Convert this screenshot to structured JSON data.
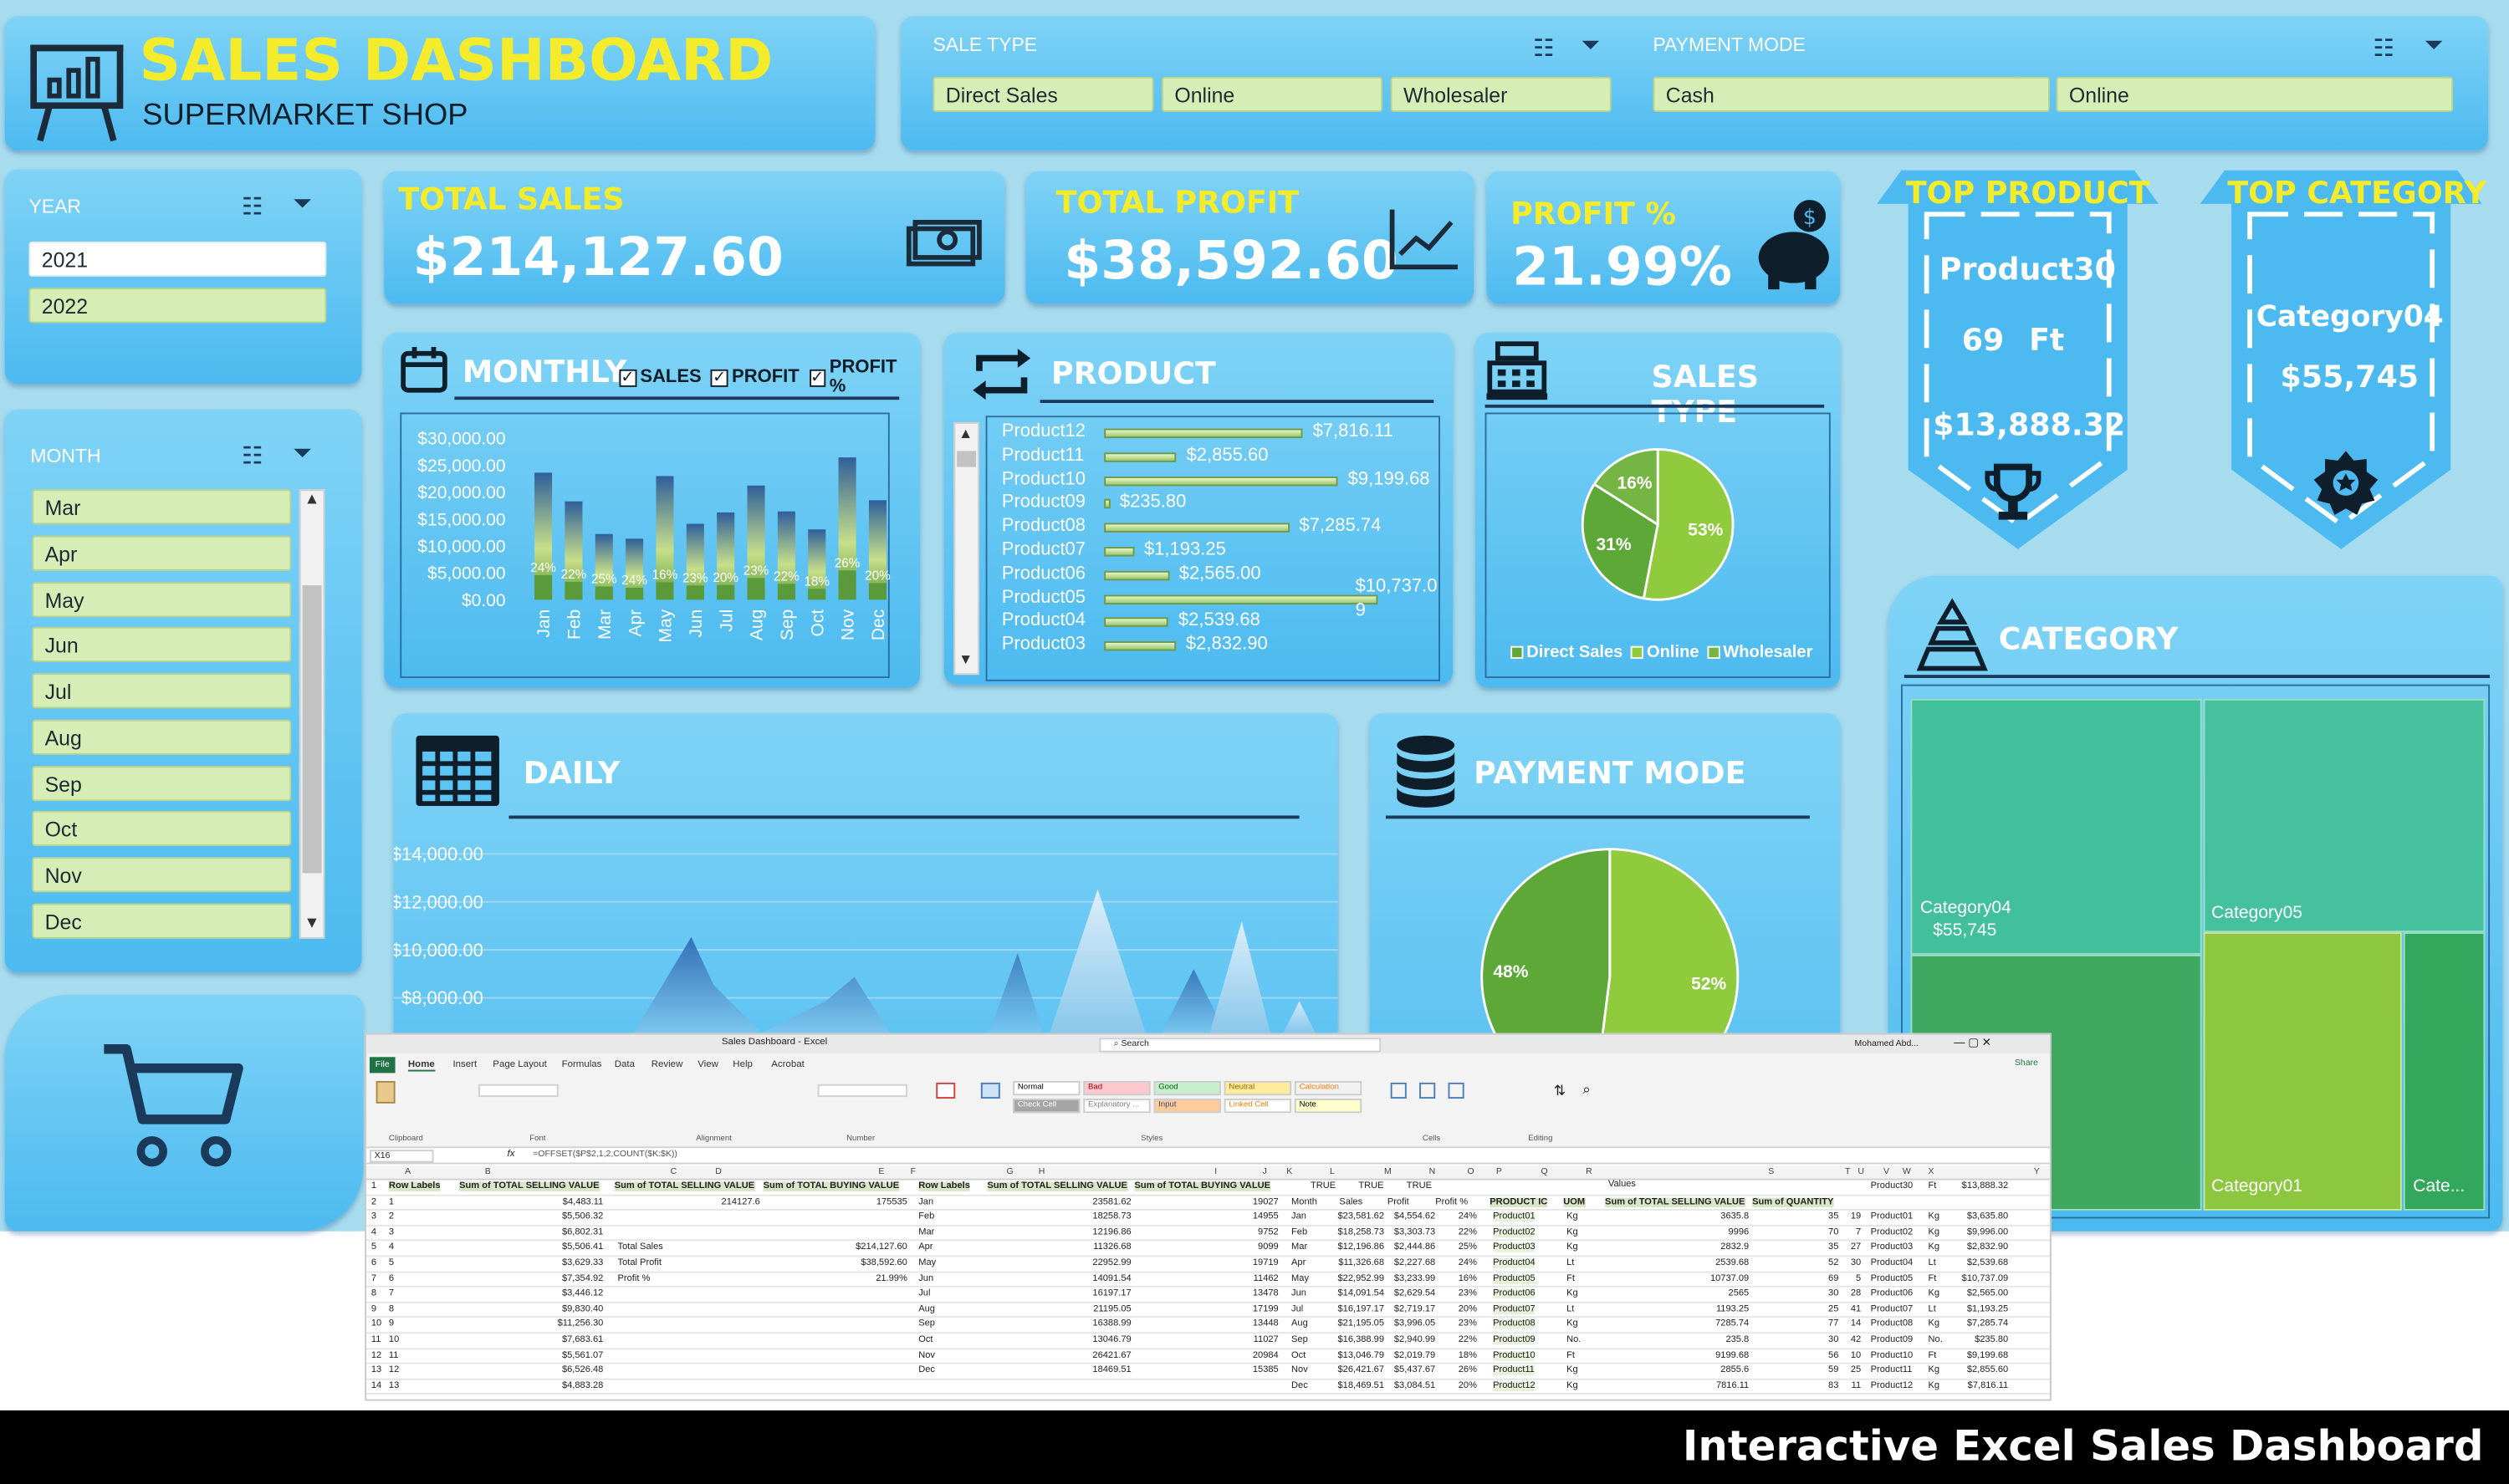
{
  "header": {
    "title": "SALES DASHBOARD",
    "subtitle": "SUPERMARKET SHOP"
  },
  "filters": {
    "sale_type": {
      "label": "SALE TYPE",
      "options": [
        "Direct Sales",
        "Online",
        "Wholesaler"
      ]
    },
    "payment_mode": {
      "label": "PAYMENT MODE",
      "options": [
        "Cash",
        "Online"
      ]
    },
    "year": {
      "label": "YEAR",
      "options": [
        "2021",
        "2022"
      ]
    },
    "month": {
      "label": "MONTH",
      "options": [
        "Mar",
        "Apr",
        "May",
        "Jun",
        "Jul",
        "Aug",
        "Sep",
        "Oct",
        "Nov",
        "Dec"
      ]
    }
  },
  "kpis": {
    "total_sales": {
      "label": "TOTAL SALES",
      "value": "$214,127.60"
    },
    "total_profit": {
      "label": "TOTAL PROFIT",
      "value": "$38,592.60"
    },
    "profit_pct": {
      "label": "PROFIT %",
      "value": "21.99%"
    }
  },
  "top_product": {
    "label": "TOP PRODUCT",
    "name": "Product30",
    "qty": "69",
    "uom": "Ft",
    "value": "$13,888.32"
  },
  "top_category": {
    "label": "TOP CATEGORY",
    "name": "Category04",
    "value": "$55,745"
  },
  "monthly": {
    "title": "MONTHLY",
    "checks": [
      "SALES",
      "PROFIT",
      "PROFIT %"
    ],
    "yticks": [
      "$30,000.00",
      "$25,000.00",
      "$20,000.00",
      "$15,000.00",
      "$10,000.00",
      "$5,000.00",
      "$0.00"
    ]
  },
  "product": {
    "title": "PRODUCT"
  },
  "sales_type": {
    "title": "SALES TYPE"
  },
  "daily": {
    "title": "DAILY",
    "yticks": [
      "$14,000.00",
      "$12,000.00",
      "$10,000.00",
      "$8,000.00"
    ]
  },
  "payment": {
    "title": "PAYMENT MODE"
  },
  "category": {
    "title": "CATEGORY",
    "labels": {
      "c04": "Category04",
      "c04v": "$55,745",
      "c05": "Category05",
      "c01": "Category01",
      "cate": "Cate..."
    }
  },
  "excel": {
    "title": "Sales Dashboard - Excel",
    "search": "Search",
    "user": "Mohamed Abd...",
    "share": "Share",
    "tabs": [
      "File",
      "Home",
      "Insert",
      "Page Layout",
      "Formulas",
      "Data",
      "Review",
      "View",
      "Help",
      "Acrobat"
    ],
    "name_box": "X16",
    "formula": "=OFFSET($P$2,1,2,COUNT($K:$K))",
    "styles": [
      "Normal",
      "Bad",
      "Good",
      "Neutral",
      "Calculation",
      "Check Cell",
      "Explanatory ...",
      "Input",
      "Linked Cell",
      "Note"
    ],
    "groups": [
      "Clipboard",
      "Font",
      "Alignment",
      "Number",
      "Styles",
      "Cells",
      "Editing"
    ],
    "col_letters": [
      "A",
      "B",
      "C",
      "D",
      "E",
      "F",
      "G",
      "H",
      "I",
      "J",
      "K",
      "L",
      "M",
      "N",
      "O",
      "P",
      "Q",
      "R",
      "S",
      "T",
      "U",
      "V",
      "W",
      "X",
      "Y"
    ],
    "t1_headers": [
      "Row Labels",
      "Sum of TOTAL SELLING VALUE"
    ],
    "t1_rows": [
      [
        "1",
        "$4,483.11"
      ],
      [
        "2",
        "$5,506.32"
      ],
      [
        "3",
        "$6,802.31"
      ],
      [
        "4",
        "$5,506.41"
      ],
      [
        "5",
        "$3,629.33"
      ],
      [
        "6",
        "$7,354.92"
      ],
      [
        "7",
        "$3,446.12"
      ],
      [
        "8",
        "$9,830.40"
      ],
      [
        "9",
        "$11,256.30"
      ],
      [
        "10",
        "$7,683.61"
      ],
      [
        "11",
        "$5,561.07"
      ],
      [
        "12",
        "$6,526.48"
      ],
      [
        "13",
        "$4,883.28"
      ]
    ],
    "t2_headers": [
      "Sum of TOTAL SELLING VALUE",
      "Sum of TOTAL BUYING VALUE"
    ],
    "t2_row": [
      "214127.6",
      "175535"
    ],
    "kpi_rows": [
      [
        "Total Sales",
        "$214,127.60"
      ],
      [
        "Total Profit",
        "$38,592.60"
      ],
      [
        "Profit %",
        "21.99%"
      ]
    ],
    "t3_headers": [
      "Row Labels",
      "Sum of TOTAL SELLING VALUE",
      "Sum of TOTAL BUYING VALUE"
    ],
    "t3_rows": [
      [
        "Jan",
        "23581.62",
        "19027"
      ],
      [
        "Feb",
        "18258.73",
        "14955"
      ],
      [
        "Mar",
        "12196.86",
        "9752"
      ],
      [
        "Apr",
        "11326.68",
        "9099"
      ],
      [
        "May",
        "22952.99",
        "19719"
      ],
      [
        "Jun",
        "14091.54",
        "11462"
      ],
      [
        "Jul",
        "16197.17",
        "13478"
      ],
      [
        "Aug",
        "21195.05",
        "17199"
      ],
      [
        "Sep",
        "16388.99",
        "13448"
      ],
      [
        "Oct",
        "13046.79",
        "11027"
      ],
      [
        "Nov",
        "26421.67",
        "20984"
      ],
      [
        "Dec",
        "18469.51",
        "15385"
      ]
    ],
    "t4_headers": [
      "",
      "TRUE",
      "TRUE",
      "TRUE"
    ],
    "t4_sub": [
      "Month",
      "Sales",
      "Profit",
      "Profit %"
    ],
    "t4_rows": [
      [
        "Jan",
        "$23,581.62",
        "$4,554.62",
        "24%"
      ],
      [
        "Feb",
        "$18,258.73",
        "$3,303.73",
        "22%"
      ],
      [
        "Mar",
        "$12,196.86",
        "$2,444.86",
        "25%"
      ],
      [
        "Apr",
        "$11,326.68",
        "$2,227.68",
        "24%"
      ],
      [
        "May",
        "$22,952.99",
        "$3,233.99",
        "16%"
      ],
      [
        "Jun",
        "$14,091.54",
        "$2,629.54",
        "23%"
      ],
      [
        "Jul",
        "$16,197.17",
        "$2,719.17",
        "20%"
      ],
      [
        "Aug",
        "$21,195.05",
        "$3,996.05",
        "23%"
      ],
      [
        "Sep",
        "$16,388.99",
        "$2,940.99",
        "22%"
      ],
      [
        "Oct",
        "$13,046.79",
        "$2,019.79",
        "18%"
      ],
      [
        "Nov",
        "$26,421.67",
        "$5,437.67",
        "26%"
      ],
      [
        "Dec",
        "$18,469.51",
        "$3,084.51",
        "20%"
      ]
    ],
    "t5_values": "Values",
    "t5_headers": [
      "PRODUCT IC",
      "UOM",
      "Sum of TOTAL SELLING VALUE",
      "Sum of QUANTITY"
    ],
    "t5_rows": [
      [
        "Product01",
        "Kg",
        "3635.8",
        "35"
      ],
      [
        "Product02",
        "Kg",
        "9996",
        "70"
      ],
      [
        "Product03",
        "Kg",
        "2832.9",
        "35"
      ],
      [
        "Product04",
        "Lt",
        "2539.68",
        "52"
      ],
      [
        "Product05",
        "Ft",
        "10737.09",
        "69"
      ],
      [
        "Product06",
        "Kg",
        "2565",
        "30"
      ],
      [
        "Product07",
        "Lt",
        "1193.25",
        "25"
      ],
      [
        "Product08",
        "Kg",
        "7285.74",
        "77"
      ],
      [
        "Product09",
        "No.",
        "235.8",
        "30"
      ],
      [
        "Product10",
        "Ft",
        "9199.68",
        "56"
      ],
      [
        "Product11",
        "Kg",
        "2855.6",
        "59"
      ],
      [
        "Product12",
        "Kg",
        "7816.11",
        "83"
      ]
    ],
    "t6_header": [
      "Product30",
      "Ft",
      "$13,888.32"
    ],
    "t6_rows": [
      [
        "19",
        "Product01",
        "Kg",
        "$3,635.80"
      ],
      [
        "7",
        "Product02",
        "Kg",
        "$9,996.00"
      ],
      [
        "27",
        "Product03",
        "Kg",
        "$2,832.90"
      ],
      [
        "30",
        "Product04",
        "Lt",
        "$2,539.68"
      ],
      [
        "5",
        "Product05",
        "Ft",
        "$10,737.09"
      ],
      [
        "28",
        "Product06",
        "Kg",
        "$2,565.00"
      ],
      [
        "41",
        "Product07",
        "Lt",
        "$1,193.25"
      ],
      [
        "14",
        "Product08",
        "Kg",
        "$7,285.74"
      ],
      [
        "42",
        "Product09",
        "No.",
        "$235.80"
      ],
      [
        "10",
        "Product10",
        "Ft",
        "$9,199.68"
      ],
      [
        "25",
        "Product11",
        "Kg",
        "$2,855.60"
      ],
      [
        "11",
        "Product12",
        "Kg",
        "$7,816.11"
      ]
    ]
  },
  "footer": {
    "text": "Interactive Excel Sales Dashboard"
  },
  "chart_data": [
    {
      "type": "bar",
      "title": "MONTHLY",
      "categories": [
        "Jan",
        "Feb",
        "Mar",
        "Apr",
        "May",
        "Jun",
        "Jul",
        "Aug",
        "Sep",
        "Oct",
        "Nov",
        "Dec"
      ],
      "series": [
        {
          "name": "SALES",
          "values": [
            23581.62,
            18258.73,
            12196.86,
            11326.68,
            22952.99,
            14091.54,
            16197.17,
            21195.05,
            16388.99,
            13046.79,
            26421.67,
            18469.51
          ]
        },
        {
          "name": "PROFIT",
          "values": [
            4554.62,
            3303.73,
            2444.86,
            2227.68,
            3233.99,
            2629.54,
            2719.17,
            3996.05,
            2940.99,
            2019.79,
            5437.67,
            3084.51
          ]
        },
        {
          "name": "PROFIT %",
          "values": [
            24,
            22,
            25,
            24,
            16,
            23,
            20,
            23,
            22,
            18,
            26,
            20
          ]
        }
      ],
      "ylim": [
        0,
        30000
      ]
    },
    {
      "type": "bar",
      "title": "PRODUCT",
      "categories": [
        "Product12",
        "Product11",
        "Product10",
        "Product09",
        "Product08",
        "Product07",
        "Product06",
        "Product05",
        "Product04",
        "Product03"
      ],
      "values": [
        7816.11,
        2855.6,
        9199.68,
        235.8,
        7285.74,
        1193.25,
        2565.0,
        10737.09,
        2539.68,
        2832.9
      ],
      "labels": [
        "$7,816.11",
        "$2,855.60",
        "$9,199.68",
        "$235.80",
        "$7,285.74",
        "$1,193.25",
        "$2,565.00",
        "$10,737.0 9",
        "$2,539.68",
        "$2,832.90"
      ]
    },
    {
      "type": "pie",
      "title": "SALES TYPE",
      "categories": [
        "Direct Sales",
        "Online",
        "Wholesaler"
      ],
      "values": [
        31,
        53,
        16
      ],
      "colors": [
        "#5ea838",
        "#8fcb3c",
        "#74b544"
      ]
    },
    {
      "type": "area",
      "title": "DAILY",
      "ylim": [
        8000,
        14000
      ]
    },
    {
      "type": "pie",
      "title": "PAYMENT MODE",
      "categories": [
        "Cash",
        "Online"
      ],
      "values": [
        48,
        52
      ],
      "colors": [
        "#5ea838",
        "#8fcb3c"
      ]
    },
    {
      "type": "heatmap",
      "title": "CATEGORY",
      "categories": [
        "Category04",
        "Category05",
        "Category01",
        "Cate..."
      ],
      "values": [
        55745
      ],
      "colors": [
        "#42c09b",
        "#3fa860",
        "#8cc73f",
        "#33a85c"
      ]
    }
  ]
}
